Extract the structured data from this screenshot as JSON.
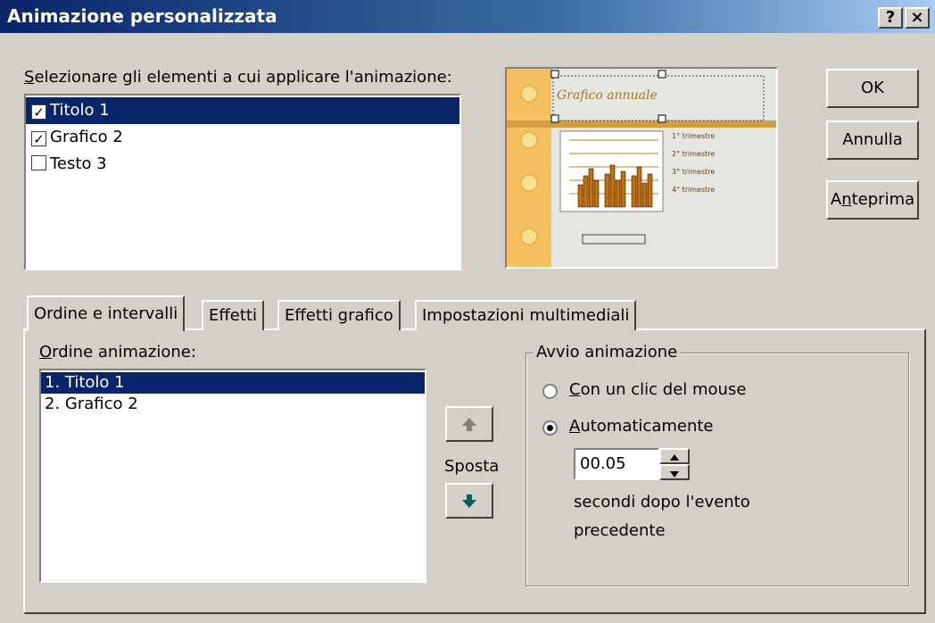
{
  "window": {
    "title": "Animazione personalizzata",
    "help_label": "?",
    "close_label": "×"
  },
  "elements_section": {
    "label_first": "S",
    "label_rest": "elezionare gli elementi a cui applicare l'animazione:",
    "items": [
      {
        "label": "Titolo 1",
        "checked": true,
        "selected": true
      },
      {
        "label": "Grafico 2",
        "checked": true,
        "selected": false
      },
      {
        "label": "Testo 3",
        "checked": false,
        "selected": false
      }
    ]
  },
  "preview": {
    "slide_title": "Grafico annuale",
    "legend": [
      "1° trimestre",
      "2° trimestre",
      "3° trimestre",
      "4° trimestre"
    ]
  },
  "buttons": {
    "ok": "OK",
    "cancel": "Annulla",
    "preview_a": "A",
    "preview_n": "n",
    "preview_rest": "teprima"
  },
  "tabs": [
    "Ordine e intervalli",
    "Effetti",
    "Effetti grafico",
    "Impostazioni multimediali"
  ],
  "order_section": {
    "label_first": "O",
    "label_rest": "rdine animazione:",
    "items": [
      "1. Titolo 1",
      "2. Grafico 2"
    ],
    "move_label": "Sposta"
  },
  "start_section": {
    "legend": "Avvio animazione",
    "option_click_first": "C",
    "option_click_rest": "on un clic del mouse",
    "option_auto_first": "A",
    "option_auto_rest": "utomaticamente",
    "selected_option": "auto",
    "delay_value": "00.05",
    "delay_note_line1": "secondi dopo l'evento",
    "delay_note_line2": "precedente"
  }
}
